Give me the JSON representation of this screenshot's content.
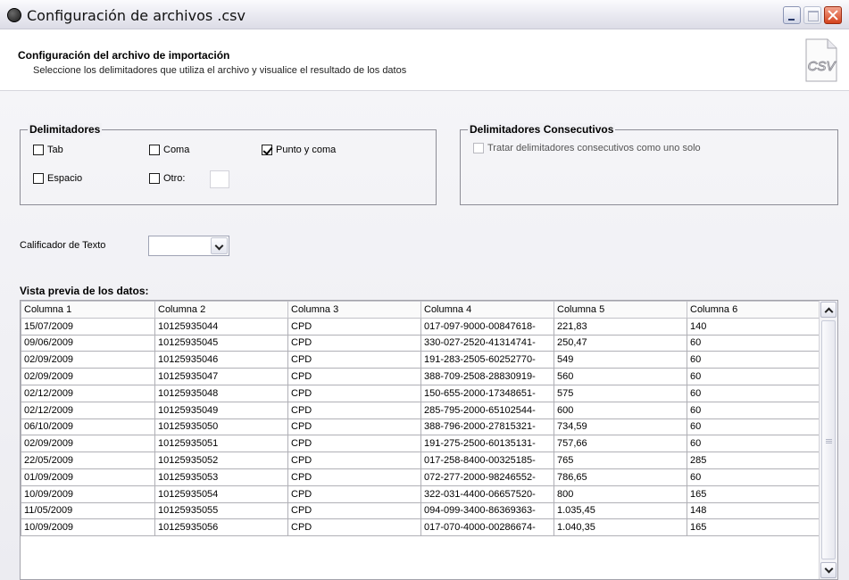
{
  "window": {
    "title": "Configuración de archivos .csv"
  },
  "header": {
    "title": "Configuración del archivo de importación",
    "subtitle": "Seleccione los delimitadores que utiliza el archivo y visualice el resultado de los datos",
    "icon_label": "CSV"
  },
  "delimiters": {
    "legend": "Delimitadores",
    "tab": {
      "label": "Tab",
      "checked": false
    },
    "coma": {
      "label": "Coma",
      "checked": false
    },
    "punto_coma": {
      "label": "Punto y coma",
      "checked": true
    },
    "espacio": {
      "label": "Espacio",
      "checked": false
    },
    "otro": {
      "label": "Otro:",
      "checked": false,
      "value": ""
    }
  },
  "consecutive": {
    "legend": "Delimitadores Consecutivos",
    "option": {
      "label": "Tratar delimitadores consecutivos como uno solo",
      "checked": false
    }
  },
  "text_qualifier": {
    "label": "Calificador de Texto",
    "value": ""
  },
  "preview": {
    "label": "Vista previa de los datos:",
    "columns": [
      "Columna 1",
      "Columna 2",
      "Columna 3",
      "Columna 4",
      "Columna 5",
      "Columna 6"
    ],
    "rows": [
      [
        "15/07/2009",
        "10125935044",
        "CPD",
        "017-097-9000-00847618-",
        "221,83",
        "140"
      ],
      [
        "09/06/2009",
        "10125935045",
        "CPD",
        "330-027-2520-41314741-",
        "250,47",
        "60"
      ],
      [
        "02/09/2009",
        "10125935046",
        "CPD",
        "191-283-2505-60252770-",
        "549",
        "60"
      ],
      [
        "02/09/2009",
        "10125935047",
        "CPD",
        "388-709-2508-28830919-",
        "560",
        "60"
      ],
      [
        "02/12/2009",
        "10125935048",
        "CPD",
        "150-655-2000-17348651-",
        "575",
        "60"
      ],
      [
        "02/12/2009",
        "10125935049",
        "CPD",
        "285-795-2000-65102544-",
        "600",
        "60"
      ],
      [
        "06/10/2009",
        "10125935050",
        "CPD",
        "388-796-2000-27815321-",
        "734,59",
        "60"
      ],
      [
        "02/09/2009",
        "10125935051",
        "CPD",
        "191-275-2500-60135131-",
        "757,66",
        "60"
      ],
      [
        "22/05/2009",
        "10125935052",
        "CPD",
        "017-258-8400-00325185-",
        "765",
        "285"
      ],
      [
        "01/09/2009",
        "10125935053",
        "CPD",
        "072-277-2000-98246552-",
        "786,65",
        "60"
      ],
      [
        "10/09/2009",
        "10125935054",
        "CPD",
        "322-031-4400-06657520-",
        "800",
        "165"
      ],
      [
        "11/05/2009",
        "10125935055",
        "CPD",
        "094-099-3400-86369363-",
        "1.035,45",
        "148"
      ],
      [
        "10/09/2009",
        "10125935056",
        "CPD",
        "017-070-4000-00286674-",
        "1.040,35",
        "165"
      ]
    ]
  }
}
